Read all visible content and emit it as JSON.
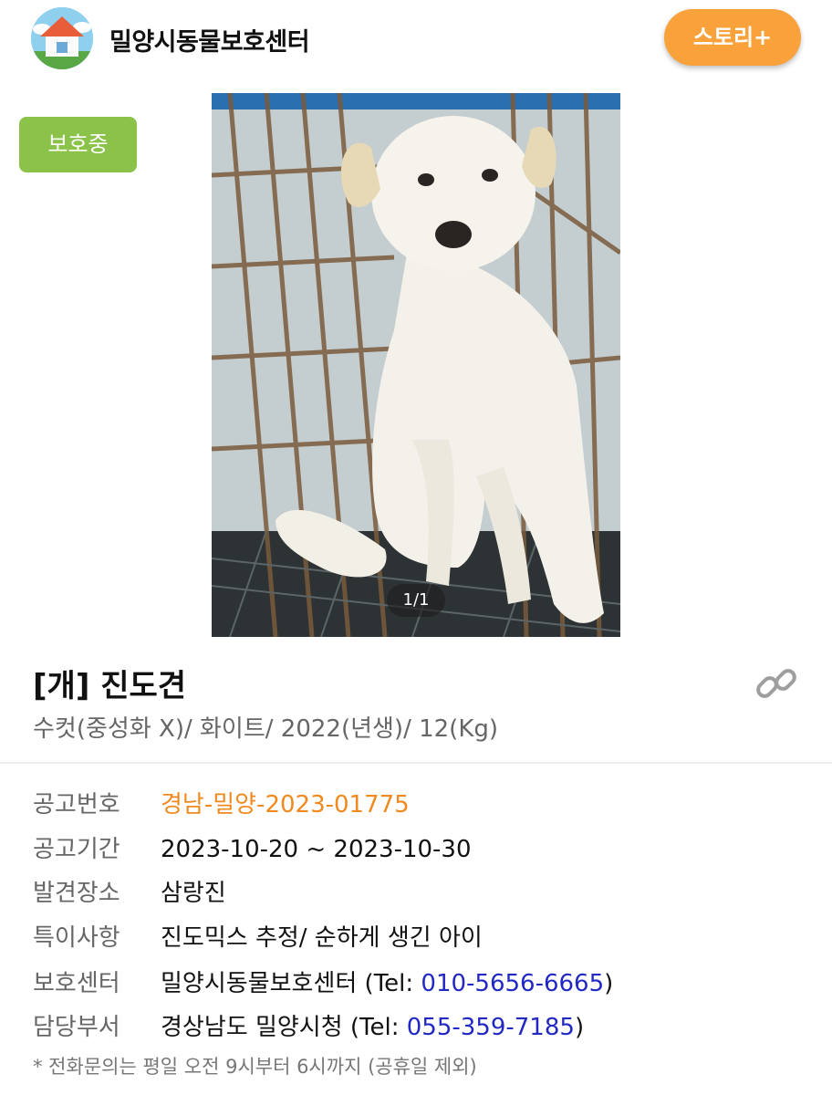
{
  "header": {
    "center_name": "밀양시동물보호센터",
    "story_button": "스토리+"
  },
  "status_badge": "보호중",
  "photo": {
    "counter": "1/1"
  },
  "animal": {
    "title": "[개] 진도견",
    "subtitle": "수컷(중성화 X)/ 화이트/ 2022(년생)/ 12(Kg)"
  },
  "info": {
    "rows": [
      {
        "label": "공고번호",
        "value": "경남-밀양-2023-01775"
      },
      {
        "label": "공고기간",
        "value": "2023-10-20 ~ 2023-10-30"
      },
      {
        "label": "발견장소",
        "value": "삼랑진"
      },
      {
        "label": "특이사항",
        "value": "진도믹스 추정/ 순하게 생긴 아이"
      },
      {
        "label": "보호센터",
        "prefix": "밀양시동물보호센터 (Tel: ",
        "tel": "010-5656-6665",
        "suffix": ")"
      },
      {
        "label": "담당부서",
        "prefix": "경상남도 밀양시청 (Tel: ",
        "tel": "055-359-7185",
        "suffix": ")"
      }
    ],
    "footnote": "* 전화문의는 평일 오전 9시부터 6시까지 (공휴일 제외)"
  },
  "icons": {
    "logo": "house-logo-icon",
    "share": "link-icon"
  },
  "colors": {
    "accent_orange": "#f9a13a",
    "status_green": "#8bc34a",
    "notice_number": "#f08a1e",
    "phone_link": "#2129c2"
  }
}
